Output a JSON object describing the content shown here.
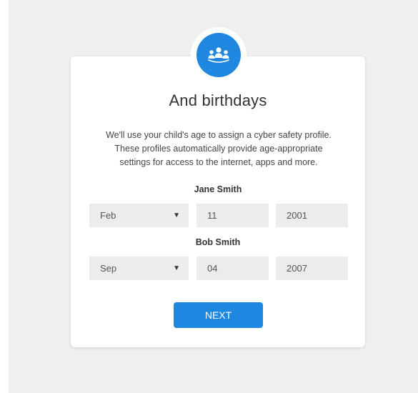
{
  "header": {
    "icon": "family-group-icon",
    "title": "And birthdays",
    "description_lines": [
      "We'll use your child's age to assign a cyber safety profile.",
      "These profiles automatically provide age-appropriate",
      "settings for access to the internet, apps and more."
    ]
  },
  "children": [
    {
      "name": "Jane Smith",
      "month": "Feb",
      "day": "11",
      "year": "2001"
    },
    {
      "name": "Bob Smith",
      "month": "Sep",
      "day": "04",
      "year": "2007"
    }
  ],
  "actions": {
    "next_label": "NEXT"
  },
  "colors": {
    "accent": "#1f87e0",
    "field_bg": "#ececec",
    "backdrop": "#efefef"
  }
}
